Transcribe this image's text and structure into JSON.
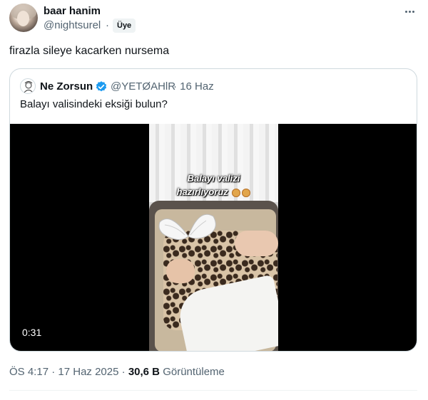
{
  "author": {
    "display_name": "baar hanim",
    "handle": "@nightsurel",
    "separator": "·",
    "badge": "Üye"
  },
  "tweet": {
    "text": "firazla sileye kacarken nursema"
  },
  "quote": {
    "display_name": "Ne Zorsun",
    "handle": "@YETØAHlR",
    "date": "· 16 Haz",
    "text": "Balayı valisindeki eksiği bulun?",
    "verified_color": "#1d9bf0",
    "video": {
      "caption_line1": "Balayı valizi",
      "caption_line2": "hazırlıyoruz",
      "duration": "0:31"
    }
  },
  "footer": {
    "time": "ÖS 4:17",
    "date": "17 Haz 2025",
    "views_count": "30,6 B",
    "views_label": "Görüntüleme"
  },
  "icons": {
    "more": "more-horizontal-icon",
    "verified": "verified-badge-icon"
  }
}
